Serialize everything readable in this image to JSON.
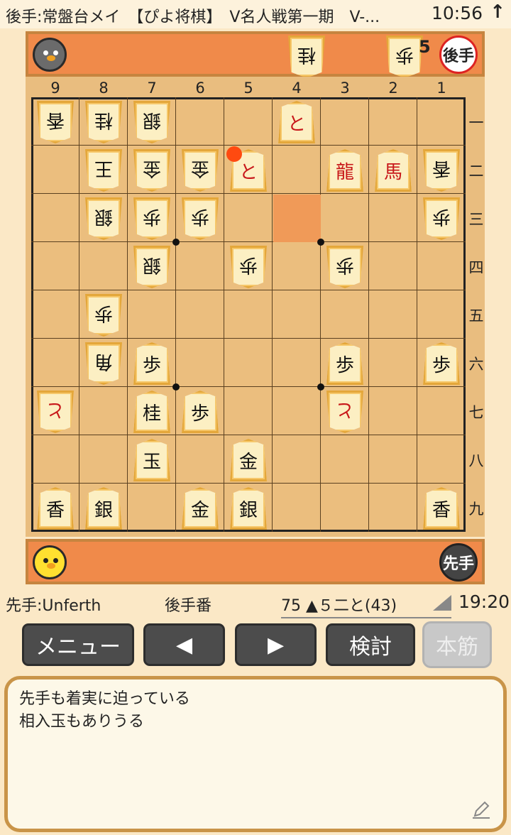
{
  "status_bar": {
    "title": "後手:常盤台メイ　【ぴよ将棋】　V名人戦第一期　V-...",
    "clock": "10:56",
    "arrow_icon": "up-arrow-icon"
  },
  "gote": {
    "badge": "後手",
    "hand": [
      {
        "label": "桂",
        "count": ""
      },
      {
        "label": "歩",
        "count": "5"
      }
    ]
  },
  "sente": {
    "badge": "先手"
  },
  "coords": {
    "files": [
      "9",
      "8",
      "7",
      "6",
      "5",
      "4",
      "3",
      "2",
      "1"
    ],
    "ranks": [
      "一",
      "二",
      "三",
      "四",
      "五",
      "六",
      "七",
      "八",
      "九"
    ]
  },
  "board": [
    {
      "sq": "91",
      "label": "香",
      "gote": true,
      "red": false
    },
    {
      "sq": "81",
      "label": "桂",
      "gote": true,
      "red": false
    },
    {
      "sq": "71",
      "label": "銀",
      "gote": true,
      "red": false
    },
    {
      "sq": "41",
      "label": "と",
      "gote": false,
      "red": true
    },
    {
      "sq": "82",
      "label": "王",
      "gote": true,
      "red": false
    },
    {
      "sq": "72",
      "label": "金",
      "gote": true,
      "red": false
    },
    {
      "sq": "62",
      "label": "金",
      "gote": true,
      "red": false
    },
    {
      "sq": "52",
      "label": "と",
      "gote": false,
      "red": true
    },
    {
      "sq": "32",
      "label": "龍",
      "gote": false,
      "red": true
    },
    {
      "sq": "22",
      "label": "馬",
      "gote": false,
      "red": true
    },
    {
      "sq": "12",
      "label": "香",
      "gote": true,
      "red": false
    },
    {
      "sq": "83",
      "label": "銀",
      "gote": true,
      "red": false
    },
    {
      "sq": "73",
      "label": "歩",
      "gote": true,
      "red": false
    },
    {
      "sq": "63",
      "label": "歩",
      "gote": true,
      "red": false
    },
    {
      "sq": "13",
      "label": "歩",
      "gote": true,
      "red": false
    },
    {
      "sq": "74",
      "label": "銀",
      "gote": true,
      "red": false
    },
    {
      "sq": "54",
      "label": "歩",
      "gote": true,
      "red": false
    },
    {
      "sq": "34",
      "label": "歩",
      "gote": true,
      "red": false
    },
    {
      "sq": "85",
      "label": "歩",
      "gote": true,
      "red": false
    },
    {
      "sq": "86",
      "label": "角",
      "gote": true,
      "red": false
    },
    {
      "sq": "76",
      "label": "歩",
      "gote": false,
      "red": false
    },
    {
      "sq": "36",
      "label": "歩",
      "gote": false,
      "red": false
    },
    {
      "sq": "16",
      "label": "歩",
      "gote": false,
      "red": false
    },
    {
      "sq": "97",
      "label": "と",
      "gote": true,
      "red": true
    },
    {
      "sq": "77",
      "label": "桂",
      "gote": false,
      "red": false
    },
    {
      "sq": "67",
      "label": "歩",
      "gote": false,
      "red": false
    },
    {
      "sq": "37",
      "label": "と",
      "gote": true,
      "red": true
    },
    {
      "sq": "78",
      "label": "玉",
      "gote": false,
      "red": false
    },
    {
      "sq": "58",
      "label": "金",
      "gote": false,
      "red": false
    },
    {
      "sq": "99",
      "label": "香",
      "gote": false,
      "red": false
    },
    {
      "sq": "89",
      "label": "銀",
      "gote": false,
      "red": false
    },
    {
      "sq": "69",
      "label": "金",
      "gote": false,
      "red": false
    },
    {
      "sq": "59",
      "label": "銀",
      "gote": false,
      "red": false
    },
    {
      "sq": "19",
      "label": "香",
      "gote": false,
      "red": false
    }
  ],
  "last_move_from_square": "43",
  "last_move_marker_square": "52",
  "info": {
    "sente_name": "先手:Unferth",
    "turn": "後手番",
    "move": "75 ▲５二と(43)",
    "time": "19:20"
  },
  "buttons": {
    "menu": "メニュー",
    "prev": "◀",
    "next": "▶",
    "review": "検討",
    "mainline": "本筋"
  },
  "comment": {
    "line1": "先手も着実に迫っている",
    "line2": "相入玉もありうる"
  },
  "icons": {
    "edit": "pencil-icon"
  }
}
